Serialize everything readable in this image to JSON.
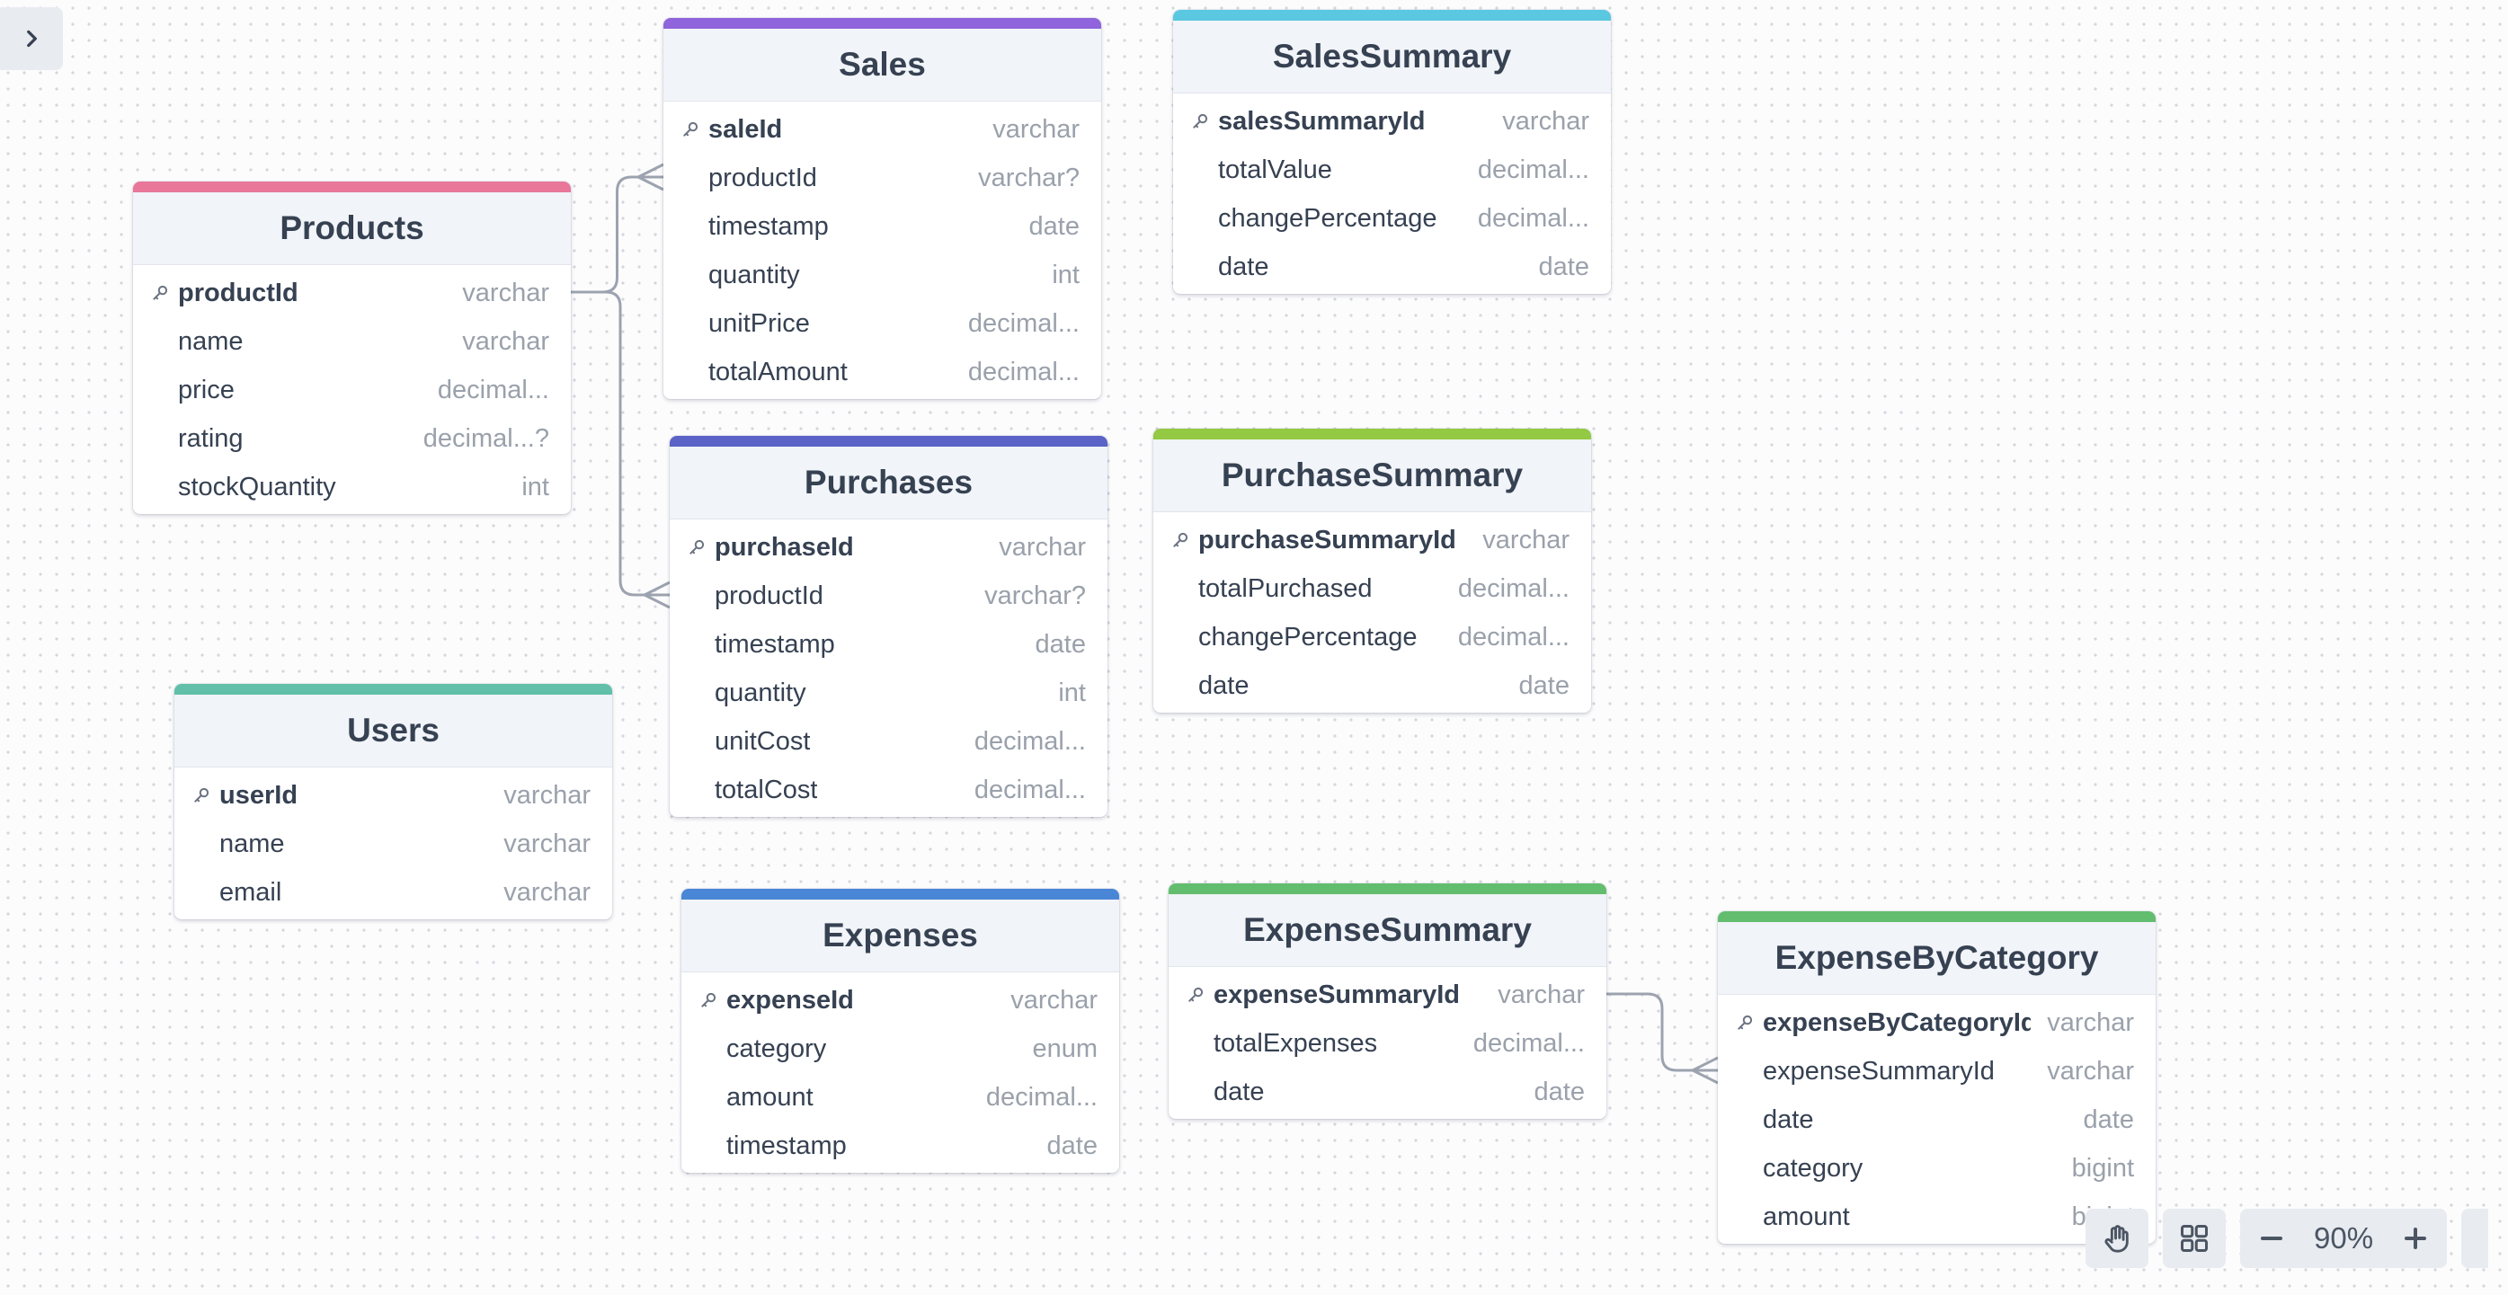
{
  "sidebar_toggle": {
    "icon": "chevron-right-icon",
    "glyph": "›"
  },
  "tables": [
    {
      "id": "products",
      "name": "Products",
      "color": "#e8779a",
      "fields": [
        {
          "name": "productId",
          "type": "varchar",
          "pk": true
        },
        {
          "name": "name",
          "type": "varchar"
        },
        {
          "name": "price",
          "type": "decimal..."
        },
        {
          "name": "rating",
          "type": "decimal...?"
        },
        {
          "name": "stockQuantity",
          "type": "int"
        }
      ]
    },
    {
      "id": "sales",
      "name": "Sales",
      "color": "#9064dc",
      "fields": [
        {
          "name": "saleId",
          "type": "varchar",
          "pk": true
        },
        {
          "name": "productId",
          "type": "varchar?"
        },
        {
          "name": "timestamp",
          "type": "date"
        },
        {
          "name": "quantity",
          "type": "int"
        },
        {
          "name": "unitPrice",
          "type": "decimal..."
        },
        {
          "name": "totalAmount",
          "type": "decimal..."
        }
      ]
    },
    {
      "id": "salessummary",
      "name": "SalesSummary",
      "color": "#5ac8e0",
      "fields": [
        {
          "name": "salesSummaryId",
          "type": "varchar",
          "pk": true
        },
        {
          "name": "totalValue",
          "type": "decimal..."
        },
        {
          "name": "changePercentage",
          "type": "decimal..."
        },
        {
          "name": "date",
          "type": "date"
        }
      ]
    },
    {
      "id": "purchases",
      "name": "Purchases",
      "color": "#5b63c7",
      "fields": [
        {
          "name": "purchaseId",
          "type": "varchar",
          "pk": true
        },
        {
          "name": "productId",
          "type": "varchar?"
        },
        {
          "name": "timestamp",
          "type": "date"
        },
        {
          "name": "quantity",
          "type": "int"
        },
        {
          "name": "unitCost",
          "type": "decimal..."
        },
        {
          "name": "totalCost",
          "type": "decimal..."
        }
      ]
    },
    {
      "id": "purchasesummary",
      "name": "PurchaseSummary",
      "color": "#93c943",
      "fields": [
        {
          "name": "purchaseSummaryId",
          "type": "varchar",
          "pk": true
        },
        {
          "name": "totalPurchased",
          "type": "decimal..."
        },
        {
          "name": "changePercentage",
          "type": "decimal..."
        },
        {
          "name": "date",
          "type": "date"
        }
      ]
    },
    {
      "id": "users",
      "name": "Users",
      "color": "#62bfaa",
      "fields": [
        {
          "name": "userId",
          "type": "varchar",
          "pk": true
        },
        {
          "name": "name",
          "type": "varchar"
        },
        {
          "name": "email",
          "type": "varchar"
        }
      ]
    },
    {
      "id": "expenses",
      "name": "Expenses",
      "color": "#4a86d6",
      "fields": [
        {
          "name": "expenseId",
          "type": "varchar",
          "pk": true
        },
        {
          "name": "category",
          "type": "enum"
        },
        {
          "name": "amount",
          "type": "decimal..."
        },
        {
          "name": "timestamp",
          "type": "date"
        }
      ]
    },
    {
      "id": "expensesummary",
      "name": "ExpenseSummary",
      "color": "#63bd6f",
      "fields": [
        {
          "name": "expenseSummaryId",
          "type": "varchar",
          "pk": true
        },
        {
          "name": "totalExpenses",
          "type": "decimal..."
        },
        {
          "name": "date",
          "type": "date"
        }
      ]
    },
    {
      "id": "expensebycategory",
      "name": "ExpenseByCategory",
      "color": "#63bd6f",
      "fields": [
        {
          "name": "expenseByCategoryId",
          "type": "varchar",
          "pk": true
        },
        {
          "name": "expenseSummaryId",
          "type": "varchar"
        },
        {
          "name": "date",
          "type": "date"
        },
        {
          "name": "category",
          "type": "bigint"
        },
        {
          "name": "amount",
          "type": "bigint"
        }
      ]
    }
  ],
  "relationships": [
    {
      "from_table": "products",
      "from_field": "productId",
      "to_table": "sales",
      "to_field": "productId"
    },
    {
      "from_table": "products",
      "from_field": "productId",
      "to_table": "purchases",
      "to_field": "productId"
    },
    {
      "from_table": "expensesummary",
      "from_field": "expenseSummaryId",
      "to_table": "expensebycategory",
      "to_field": "expenseSummaryId"
    }
  ],
  "toolbar": {
    "pan_icon": "hand-icon",
    "layout_icon": "grid-icon",
    "zoom_out_icon": "minus-icon",
    "zoom_level": "90%",
    "zoom_in_icon": "plus-icon"
  }
}
